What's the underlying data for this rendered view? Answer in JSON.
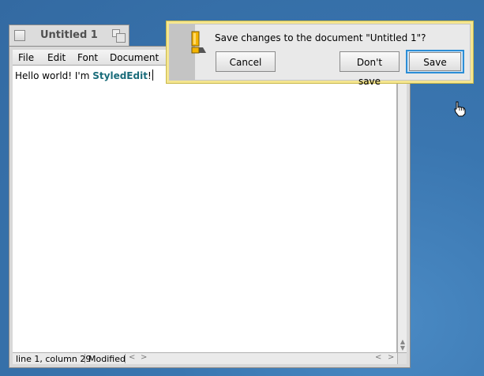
{
  "window": {
    "title": "Untitled 1",
    "menu": [
      "File",
      "Edit",
      "Font",
      "Document"
    ],
    "content": {
      "plain": "Hello world! I'm ",
      "styled": "StyledEdit",
      "after": "!"
    },
    "status": {
      "position": "line 1, column 29",
      "modified": "Modified"
    }
  },
  "alert": {
    "message": "Save changes to the document \"Untitled 1\"?",
    "buttons": {
      "cancel": "Cancel",
      "dont_save": "Don't save",
      "save": "Save"
    }
  },
  "colors": {
    "desktop": "#3a76b0",
    "styled_text": "#1a6c7a",
    "alert_border": "#f5e690",
    "default_button": "#2c8ed6"
  }
}
